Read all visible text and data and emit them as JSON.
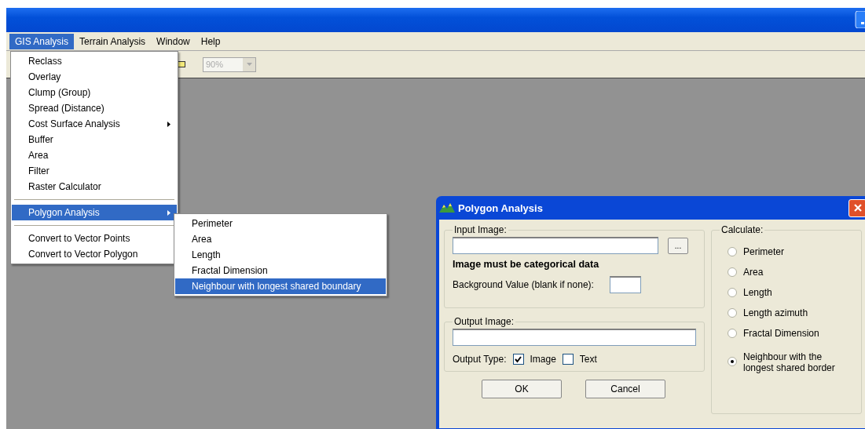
{
  "menubar": [
    {
      "label": "GIS Analysis",
      "selected": true
    },
    {
      "label": "Terrain Analysis",
      "selected": false
    },
    {
      "label": "Window",
      "selected": false
    },
    {
      "label": "Help",
      "selected": false
    }
  ],
  "toolbar": {
    "zoom": {
      "value": "90%",
      "disabled": true
    }
  },
  "menu": {
    "sections": [
      [
        {
          "label": "Reclass",
          "selected": false,
          "submenu": false
        },
        {
          "label": "Overlay",
          "selected": false,
          "submenu": false
        },
        {
          "label": "Clump (Group)",
          "selected": false,
          "submenu": false
        },
        {
          "label": "Spread (Distance)",
          "selected": false,
          "submenu": false
        },
        {
          "label": "Cost Surface Analysis",
          "selected": false,
          "submenu": true
        },
        {
          "label": "Buffer",
          "selected": false,
          "submenu": false
        },
        {
          "label": "Area",
          "selected": false,
          "submenu": false
        },
        {
          "label": "Filter",
          "selected": false,
          "submenu": false
        },
        {
          "label": "Raster Calculator",
          "selected": false,
          "submenu": false
        }
      ],
      [
        {
          "label": "Polygon Analysis",
          "selected": true,
          "submenu": true
        }
      ],
      [
        {
          "label": "Convert to Vector Points",
          "selected": false,
          "submenu": false
        },
        {
          "label": "Convert to Vector Polygon",
          "selected": false,
          "submenu": false
        }
      ]
    ]
  },
  "submenu": {
    "items": [
      {
        "label": "Perimeter",
        "selected": false
      },
      {
        "label": "Area",
        "selected": false
      },
      {
        "label": "Length",
        "selected": false
      },
      {
        "label": "Fractal Dimension",
        "selected": false
      },
      {
        "label": "Neighbour with longest shared boundary",
        "selected": true
      }
    ]
  },
  "dialog": {
    "title": "Polygon Analysis",
    "input_group": {
      "label": "Input Image:",
      "browse": "...",
      "note": "Image must be categorical data",
      "background_label": "Background Value (blank if none):"
    },
    "output_group": {
      "label": "Output Image:",
      "type_label": "Output Type:",
      "types": [
        {
          "label": "Image",
          "checked": true
        },
        {
          "label": "Text",
          "checked": false
        }
      ]
    },
    "buttons": [
      "OK",
      "Cancel"
    ],
    "calculate": {
      "label": "Calculate:",
      "options": [
        {
          "label": "Perimeter",
          "selected": false
        },
        {
          "label": "Area",
          "selected": false
        },
        {
          "label": "Length",
          "selected": false
        },
        {
          "label": "Length azimuth",
          "selected": false
        },
        {
          "label": "Fractal Dimension",
          "selected": false
        },
        {
          "label": "Neighbour with the longest shared border",
          "selected": true
        }
      ]
    }
  }
}
